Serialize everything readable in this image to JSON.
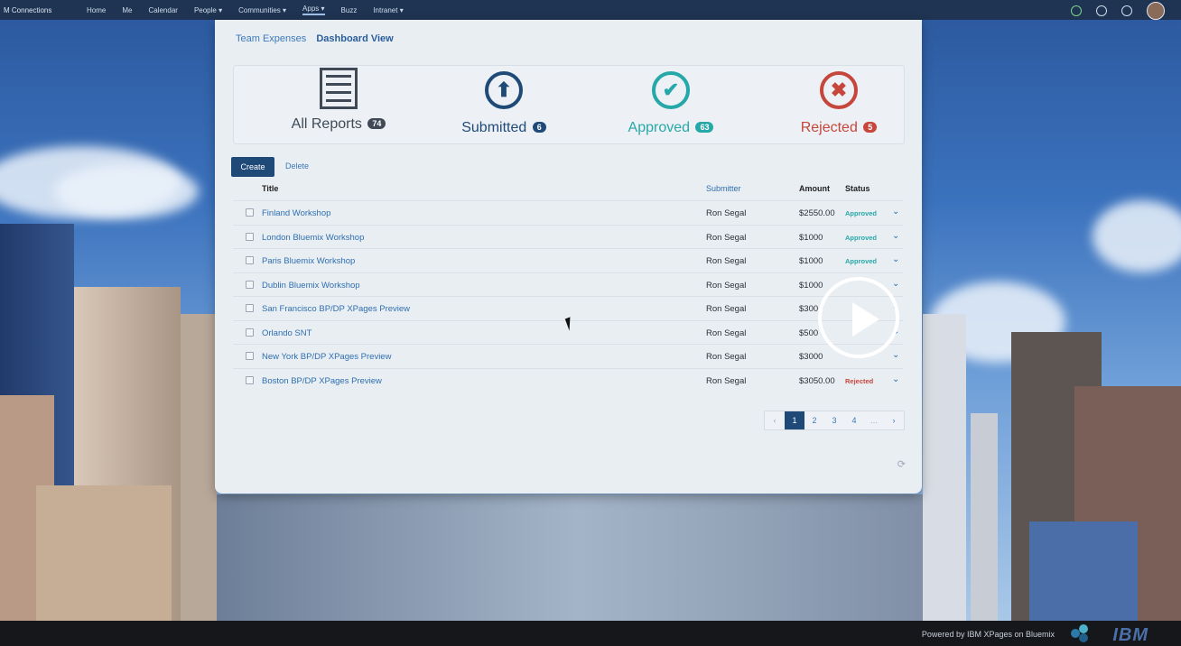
{
  "topnav": {
    "brand": "M Connections",
    "items": [
      "Home",
      "Me",
      "Calendar",
      "People",
      "Communities",
      "Apps",
      "Buzz",
      "Intranet"
    ],
    "active_item": "Apps"
  },
  "breadcrumbs": [
    "Team Expenses",
    "Dashboard View"
  ],
  "summary": [
    {
      "label": "All Reports",
      "count": "74",
      "color": "#3f4a56",
      "icon": "list-icon"
    },
    {
      "label": "Submitted",
      "count": "6",
      "color": "#1f4a78",
      "icon": "arrow-up-circle-icon"
    },
    {
      "label": "Approved",
      "count": "63",
      "color": "#27a8a8",
      "icon": "check-circle-icon"
    },
    {
      "label": "Rejected",
      "count": "5",
      "color": "#c6463b",
      "icon": "x-circle-icon"
    }
  ],
  "toolbar": {
    "create_label": "Create",
    "delete_label": "Delete"
  },
  "table": {
    "headers": {
      "title": "Title",
      "submitter": "Submitter",
      "amount": "Amount",
      "status": "Status"
    },
    "rows": [
      {
        "title": "Finland Workshop",
        "submitter": "Ron Segal",
        "amount": "$2550.00",
        "status": "Approved"
      },
      {
        "title": "London Bluemix Workshop",
        "submitter": "Ron Segal",
        "amount": "$1000",
        "status": "Approved"
      },
      {
        "title": "Paris Bluemix Workshop",
        "submitter": "Ron Segal",
        "amount": "$1000",
        "status": "Approved"
      },
      {
        "title": "Dublin Bluemix Workshop",
        "submitter": "Ron Segal",
        "amount": "$1000",
        "status": ""
      },
      {
        "title": "San Francisco BP/DP XPages Preview",
        "submitter": "Ron Segal",
        "amount": "$300",
        "status": ""
      },
      {
        "title": "Orlando SNT",
        "submitter": "Ron Segal",
        "amount": "$500",
        "status": ""
      },
      {
        "title": "New York BP/DP XPages Preview",
        "submitter": "Ron Segal",
        "amount": "$3000",
        "status": ""
      },
      {
        "title": "Boston BP/DP XPages Preview",
        "submitter": "Ron Segal",
        "amount": "$3050.00",
        "status": "Rejected"
      }
    ]
  },
  "pagination": {
    "prev": "‹",
    "pages": [
      "1",
      "2",
      "3",
      "4",
      "..."
    ],
    "next": "›",
    "current": "1"
  },
  "footer": {
    "powered_by": "Powered by IBM XPages on Bluemix",
    "ibm_logo": "IBM"
  }
}
